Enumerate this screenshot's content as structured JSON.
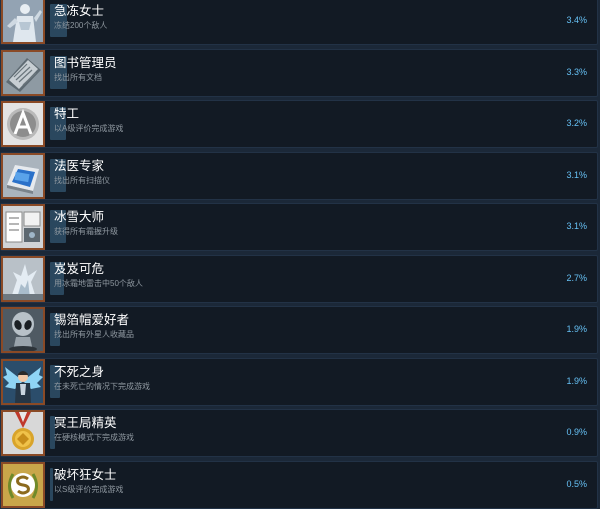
{
  "achievements": [
    {
      "title": "急冻女士",
      "desc": "冻结200个敌人",
      "percent": "3.4%",
      "icon": "ice-lady-statue-icon",
      "thumb_bg": "#a9b7c4"
    },
    {
      "title": "图书管理员",
      "desc": "找出所有文档",
      "percent": "3.3%",
      "icon": "document-folder-icon",
      "thumb_bg": "#8e9aa3"
    },
    {
      "title": "特工",
      "desc": "以A级评价完成游戏",
      "percent": "3.2%",
      "icon": "grade-a-badge-icon",
      "thumb_bg": "#e3e3e3"
    },
    {
      "title": "法医专家",
      "desc": "找出所有扫描仪",
      "percent": "3.1%",
      "icon": "scanner-device-icon",
      "thumb_bg": "#aab4bd"
    },
    {
      "title": "冰雪大师",
      "desc": "获得所有霜握升级",
      "percent": "3.1%",
      "icon": "ice-upgrade-panel-icon",
      "thumb_bg": "#d0d3d6"
    },
    {
      "title": "岌岌可危",
      "desc": "用冰霜地雷击中50个敌人",
      "percent": "2.7%",
      "icon": "frost-mine-explosion-icon",
      "thumb_bg": "#b9c1c8"
    },
    {
      "title": "锡箔帽爱好者",
      "desc": "找出所有外星人收藏品",
      "percent": "1.9%",
      "icon": "alien-figure-icon",
      "thumb_bg": "#4f5a63"
    },
    {
      "title": "不死之身",
      "desc": "在未死亡的情况下完成游戏",
      "percent": "1.9%",
      "icon": "winged-hero-icon",
      "thumb_bg": "#2b4d6b"
    },
    {
      "title": "冥王局精英",
      "desc": "在硬核模式下完成游戏",
      "percent": "0.9%",
      "icon": "gold-medal-icon",
      "thumb_bg": "#d8d8d8"
    },
    {
      "title": "破坏狂女士",
      "desc": "以S级评价完成游戏",
      "percent": "0.5%",
      "icon": "grade-s-laurel-icon",
      "thumb_bg": "#c9a64a"
    }
  ]
}
